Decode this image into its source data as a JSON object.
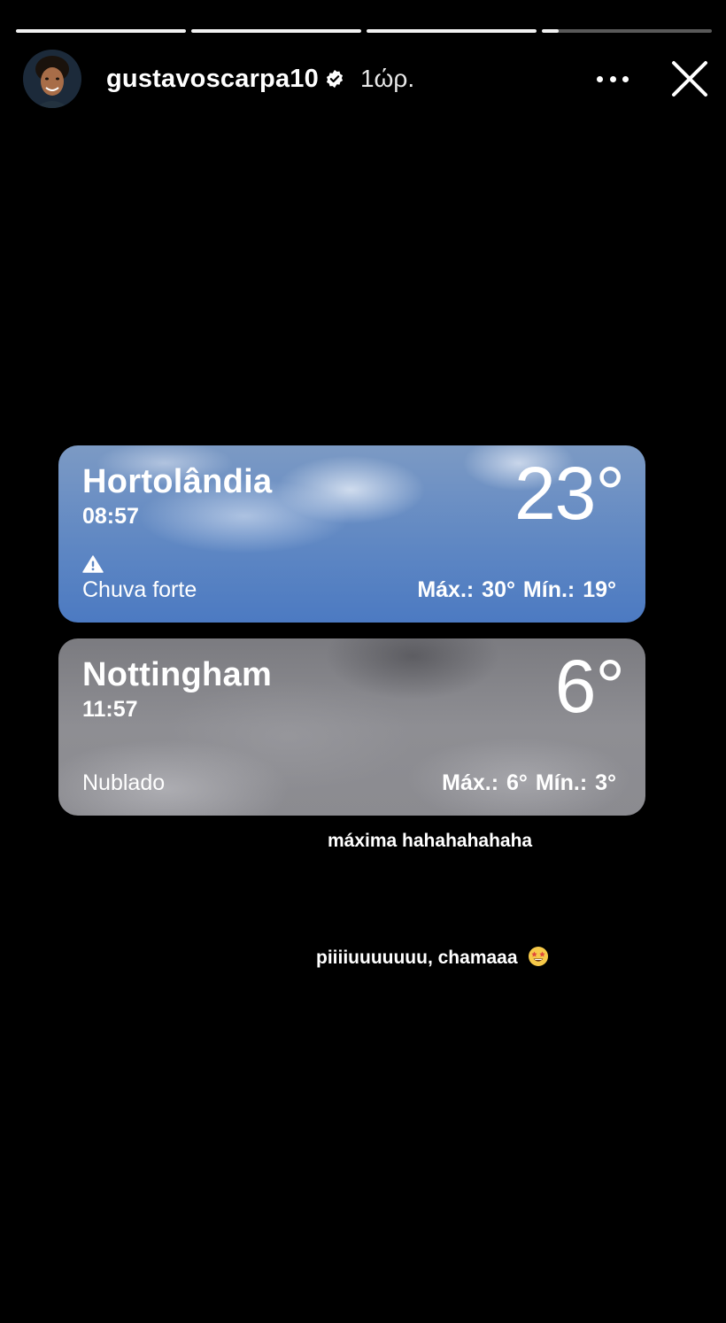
{
  "story": {
    "progress_segments": [
      {
        "fill": 1.0
      },
      {
        "fill": 1.0
      },
      {
        "fill": 1.0
      },
      {
        "fill": 0.1
      }
    ]
  },
  "header": {
    "username": "gustavoscarpa10",
    "time_ago": "1ώρ.",
    "verified_icon": "verified-badge-icon",
    "more_icon": "more-dots-icon",
    "close_icon": "close-icon"
  },
  "weather": [
    {
      "city": "Hortolândia",
      "time": "08:57",
      "temperature": "23°",
      "alert_icon": "warning-icon",
      "condition": "Chuva forte",
      "hilo": "Máx.: 30°  Mín.: 19°",
      "theme_color": "#5d86c3"
    },
    {
      "city": "Nottingham",
      "time": "11:57",
      "temperature": "6°",
      "condition": "Nublado",
      "hilo": "Máx.: 6°  Mín.: 3°",
      "theme_color": "#8e8e93"
    }
  ],
  "captions": {
    "first": "máxima hahahahahaha",
    "second": "piiiiuuuuuuu, chamaaa",
    "second_emoji": "star-struck-emoji"
  }
}
